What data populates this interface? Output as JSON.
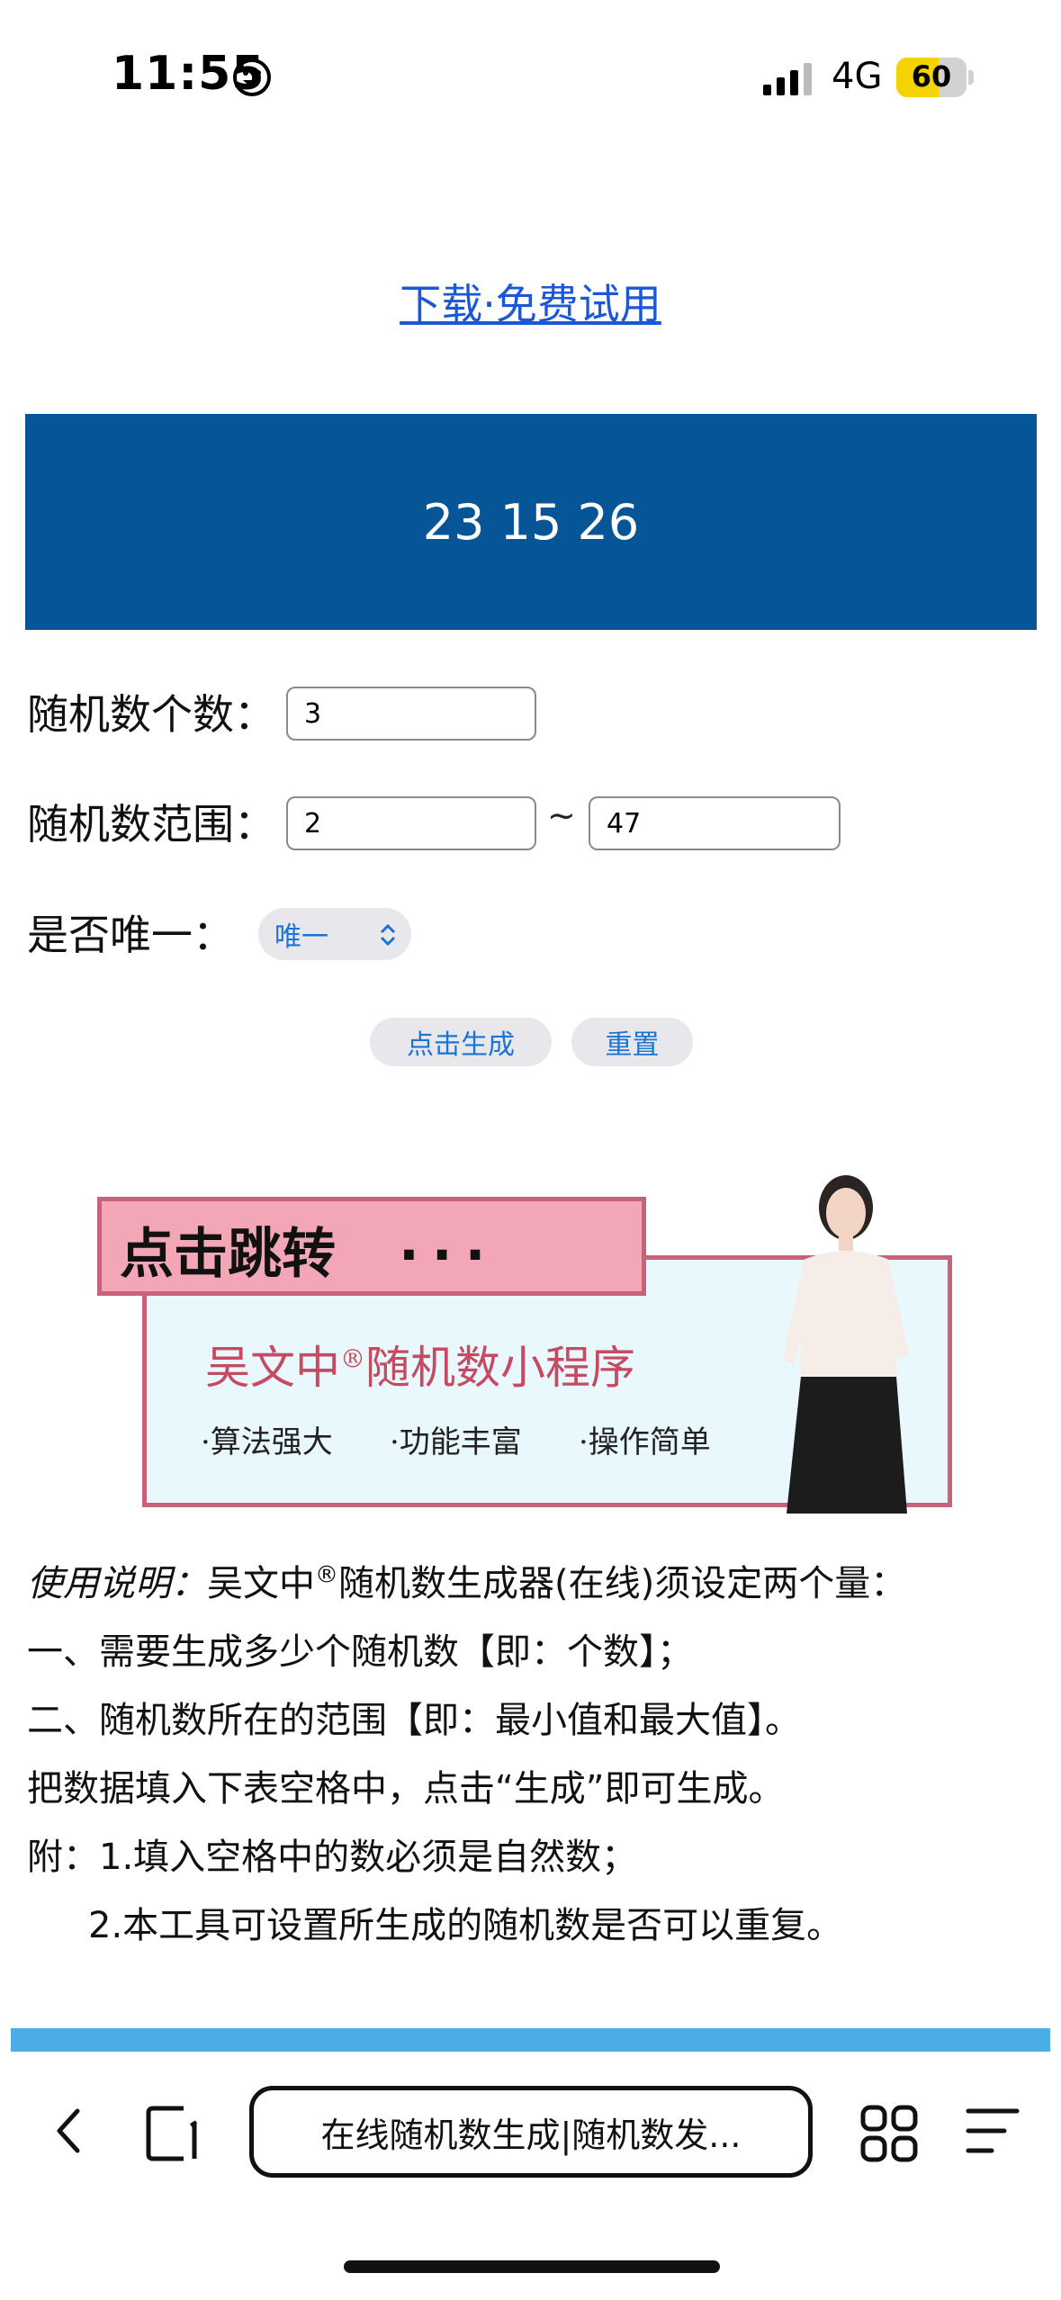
{
  "status_bar": {
    "time": "11:55",
    "network": "4G",
    "battery": "60",
    "battery_level": 0.6
  },
  "download_link": "下载·免费试用",
  "result": "23 15 26",
  "form": {
    "count_label": "随机数个数：",
    "count_value": "3",
    "range_label": "随机数范围：",
    "range_min": "2",
    "range_sep": "~",
    "range_max": "47",
    "unique_label": "是否唯一：",
    "unique_value": "唯一",
    "generate_button": "点击生成",
    "reset_button": "重置"
  },
  "ad": {
    "headline": "点击跳转",
    "dots": "...",
    "title": "吴文中",
    "title_mark": "®",
    "title_rest": "随机数小程序",
    "features": [
      "·算法强大",
      "·功能丰富",
      "·操作简单"
    ]
  },
  "instructions": {
    "intro_label": "使用说明：",
    "intro_name": "吴文中",
    "intro_mark": "®",
    "intro_rest": "随机数生成器(在线)须设定两个量：",
    "line1": "一、需要生成多少个随机数【即：个数】；",
    "line2": "二、随机数所在的范围【即：最小值和最大值】。",
    "line3": "把数据填入下表空格中，点击“生成”即可生成。",
    "note1": "附：1.填入空格中的数必须是自然数；",
    "note2": "2.本工具可设置所生成的随机数是否可以重复。"
  },
  "browser": {
    "url_title": "在线随机数生成|随机数发...",
    "icons": [
      "back-icon",
      "tab-icon",
      "grid-icon",
      "menu-icon"
    ]
  },
  "colors": {
    "banner": "#055597",
    "link": "#1b57d6",
    "bluebar": "#4aaee4",
    "accent_pink": "#c8617a"
  }
}
